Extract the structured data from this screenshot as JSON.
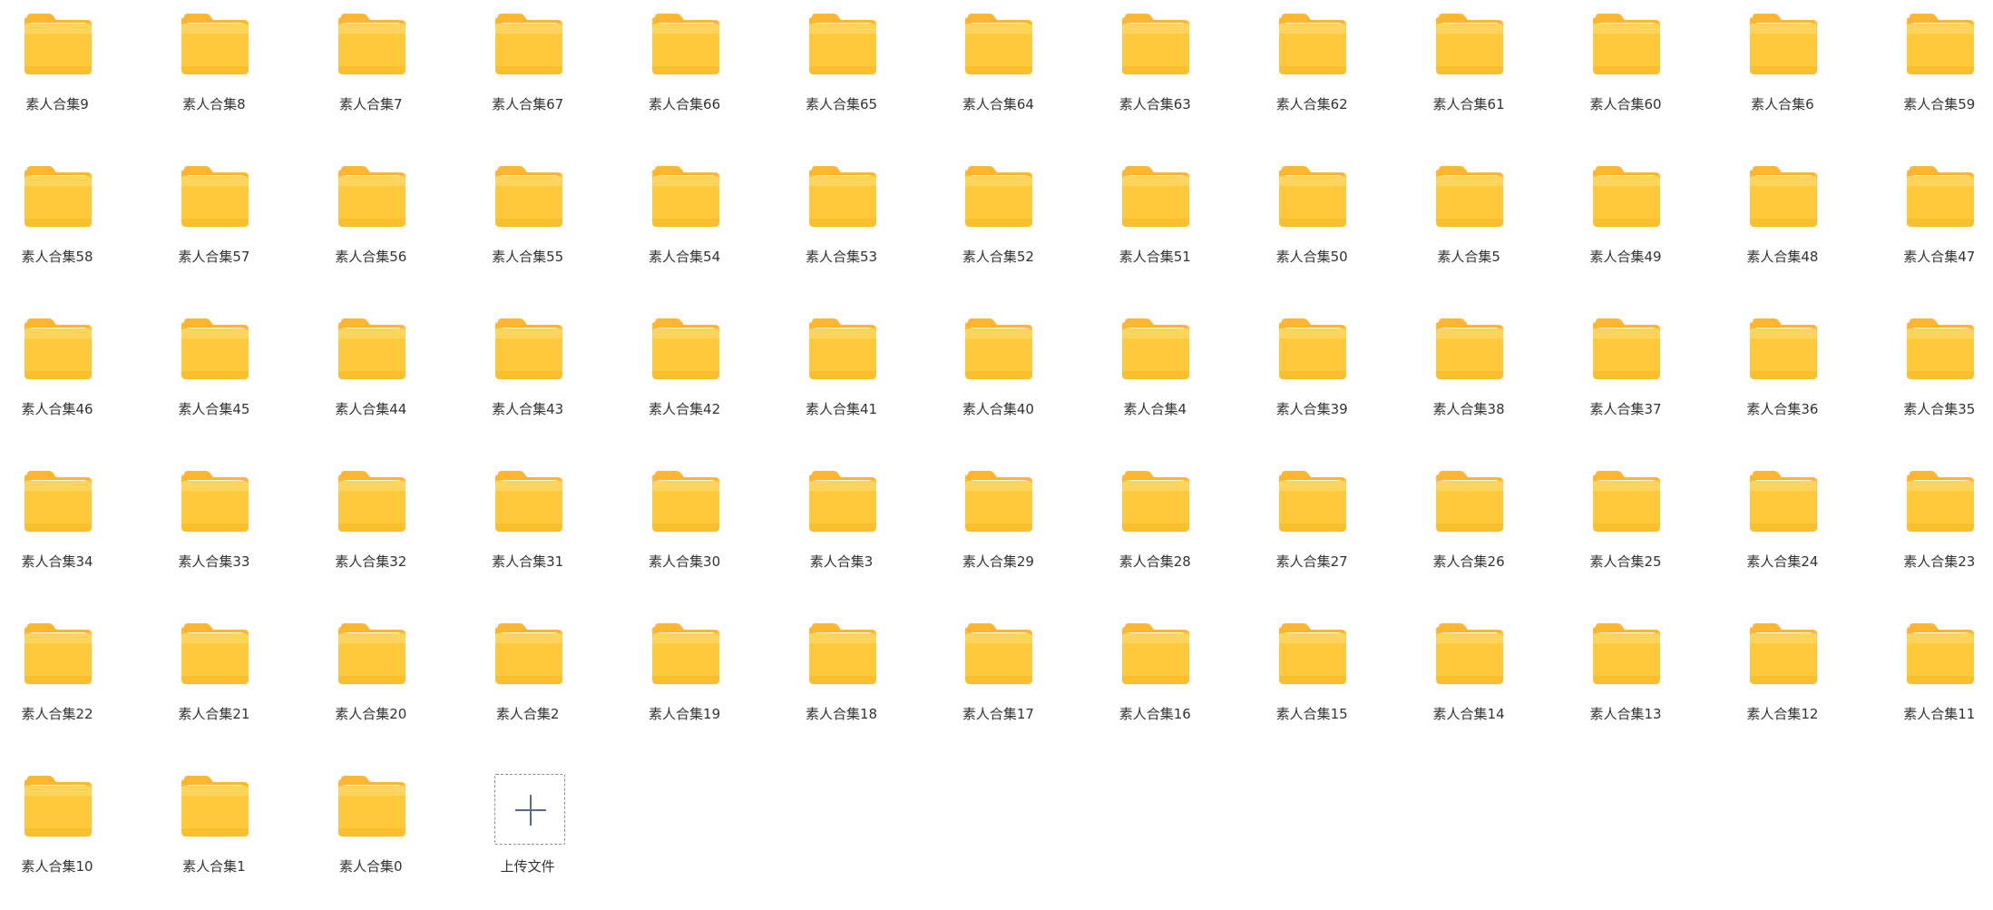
{
  "colors": {
    "folder_body": "#FFC93B",
    "folder_back": "#FFB52E",
    "label_text": "#333333",
    "upload_border": "#8C8C96",
    "upload_plus": "#5A6A8C"
  },
  "folders": [
    {
      "label": "素人合集9"
    },
    {
      "label": "素人合集8"
    },
    {
      "label": "素人合集7"
    },
    {
      "label": "素人合集67"
    },
    {
      "label": "素人合集66"
    },
    {
      "label": "素人合集65"
    },
    {
      "label": "素人合集64"
    },
    {
      "label": "素人合集63"
    },
    {
      "label": "素人合集62"
    },
    {
      "label": "素人合集61"
    },
    {
      "label": "素人合集60"
    },
    {
      "label": "素人合集6"
    },
    {
      "label": "素人合集59"
    },
    {
      "label": "素人合集58"
    },
    {
      "label": "素人合集57"
    },
    {
      "label": "素人合集56"
    },
    {
      "label": "素人合集55"
    },
    {
      "label": "素人合集54"
    },
    {
      "label": "素人合集53"
    },
    {
      "label": "素人合集52"
    },
    {
      "label": "素人合集51"
    },
    {
      "label": "素人合集50"
    },
    {
      "label": "素人合集5"
    },
    {
      "label": "素人合集49"
    },
    {
      "label": "素人合集48"
    },
    {
      "label": "素人合集47"
    },
    {
      "label": "素人合集46"
    },
    {
      "label": "素人合集45"
    },
    {
      "label": "素人合集44"
    },
    {
      "label": "素人合集43"
    },
    {
      "label": "素人合集42"
    },
    {
      "label": "素人合集41"
    },
    {
      "label": "素人合集40"
    },
    {
      "label": "素人合集4"
    },
    {
      "label": "素人合集39"
    },
    {
      "label": "素人合集38"
    },
    {
      "label": "素人合集37"
    },
    {
      "label": "素人合集36"
    },
    {
      "label": "素人合集35"
    },
    {
      "label": "素人合集34"
    },
    {
      "label": "素人合集33"
    },
    {
      "label": "素人合集32"
    },
    {
      "label": "素人合集31"
    },
    {
      "label": "素人合集30"
    },
    {
      "label": "素人合集3"
    },
    {
      "label": "素人合集29"
    },
    {
      "label": "素人合集28"
    },
    {
      "label": "素人合集27"
    },
    {
      "label": "素人合集26"
    },
    {
      "label": "素人合集25"
    },
    {
      "label": "素人合集24"
    },
    {
      "label": "素人合集23"
    },
    {
      "label": "素人合集22"
    },
    {
      "label": "素人合集21"
    },
    {
      "label": "素人合集20"
    },
    {
      "label": "素人合集2"
    },
    {
      "label": "素人合集19"
    },
    {
      "label": "素人合集18"
    },
    {
      "label": "素人合集17"
    },
    {
      "label": "素人合集16"
    },
    {
      "label": "素人合集15"
    },
    {
      "label": "素人合集14"
    },
    {
      "label": "素人合集13"
    },
    {
      "label": "素人合集12"
    },
    {
      "label": "素人合集11"
    },
    {
      "label": "素人合集10"
    },
    {
      "label": "素人合集1"
    },
    {
      "label": "素人合集0"
    }
  ],
  "upload": {
    "label": "上传文件",
    "icon": "plus-icon"
  }
}
